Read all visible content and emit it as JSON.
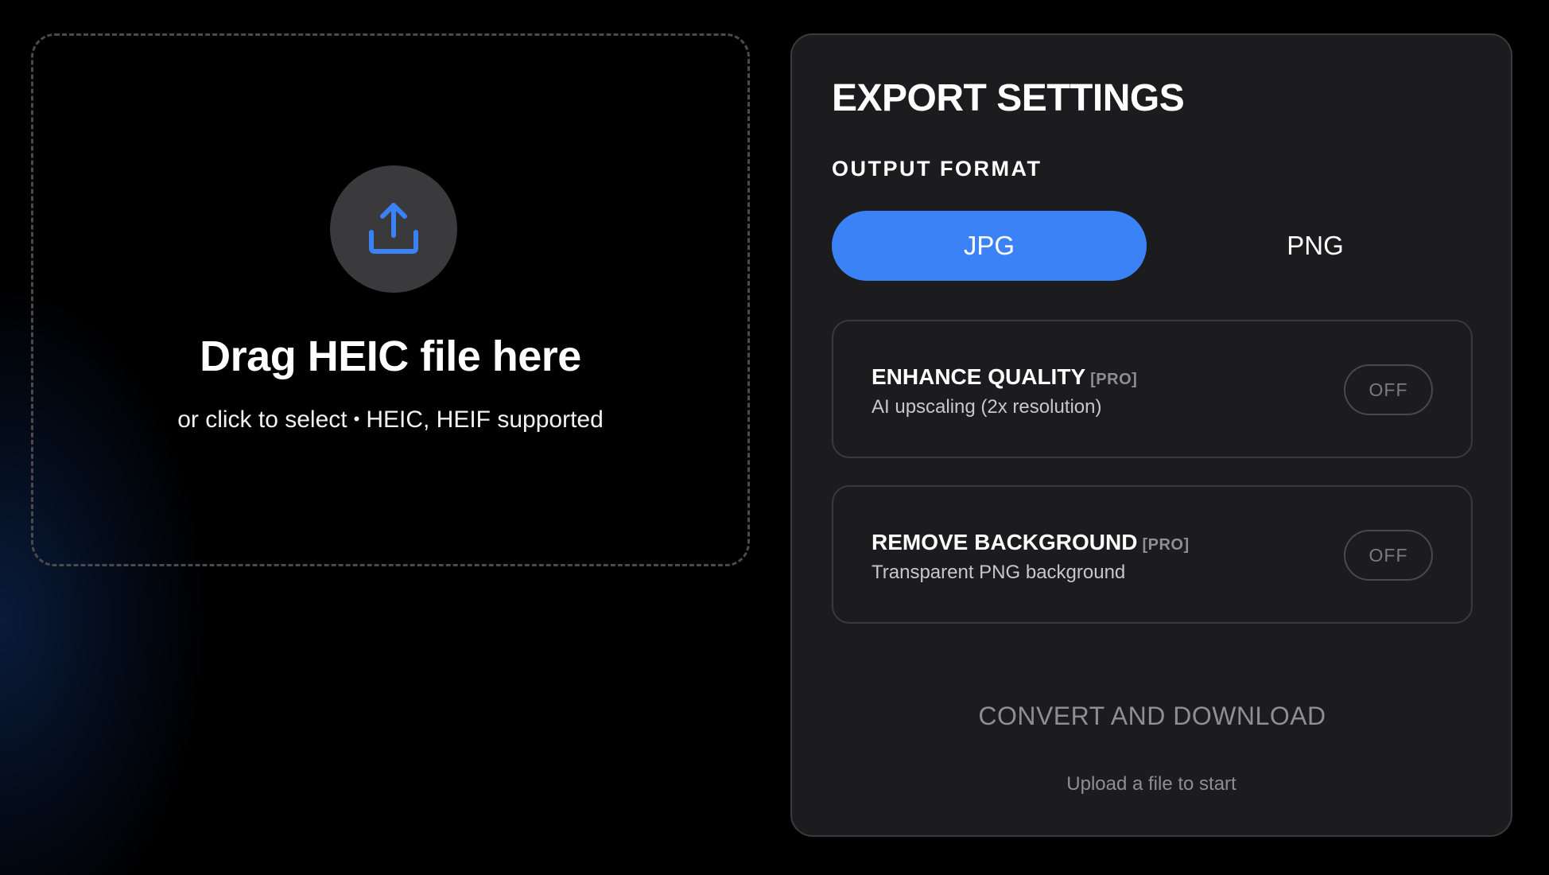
{
  "dropzone": {
    "icon": "upload-icon",
    "title": "Drag HEIC file here",
    "subtitle_main": "or click to select",
    "subtitle_sep": "•",
    "subtitle_formats": "HEIC, HEIF supported"
  },
  "settings": {
    "title": "EXPORT SETTINGS",
    "output_format_label": "OUTPUT FORMAT",
    "formats": [
      {
        "label": "JPG",
        "selected": true
      },
      {
        "label": "PNG",
        "selected": false
      }
    ],
    "options": [
      {
        "title": "ENHANCE QUALITY",
        "tag": "[PRO]",
        "description": "AI upscaling (2x resolution)",
        "toggle": "OFF"
      },
      {
        "title": "REMOVE BACKGROUND",
        "tag": "[PRO]",
        "description": "Transparent PNG background",
        "toggle": "OFF"
      }
    ],
    "convert_label": "CONVERT AND DOWNLOAD",
    "hint": "Upload a file to start"
  },
  "colors": {
    "accent": "#3b82f6",
    "panel_bg": "#1c1c1e",
    "border": "#3a3a3c",
    "muted_text": "#8e8e93"
  }
}
